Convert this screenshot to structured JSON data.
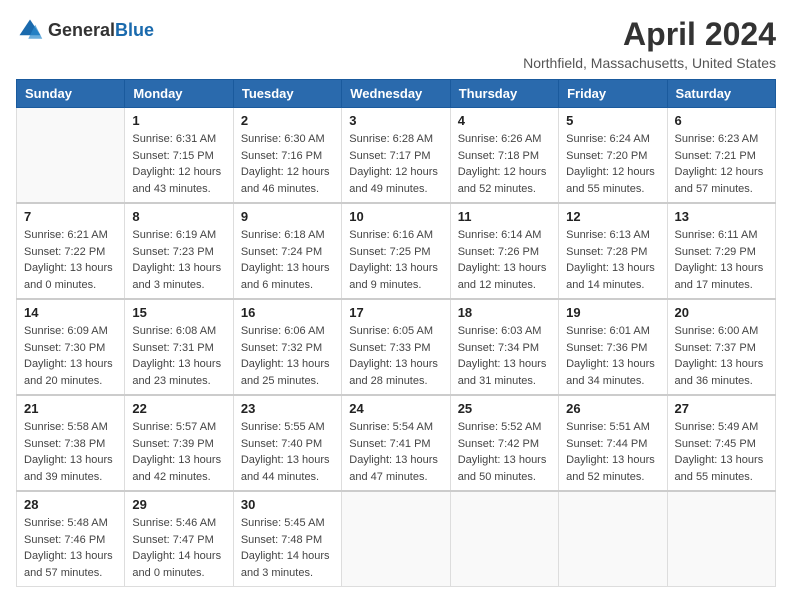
{
  "header": {
    "logo_general": "General",
    "logo_blue": "Blue",
    "month_title": "April 2024",
    "location": "Northfield, Massachusetts, United States"
  },
  "weekdays": [
    "Sunday",
    "Monday",
    "Tuesday",
    "Wednesday",
    "Thursday",
    "Friday",
    "Saturday"
  ],
  "weeks": [
    [
      {
        "day": "",
        "sunrise": "",
        "sunset": "",
        "daylight": ""
      },
      {
        "day": "1",
        "sunrise": "Sunrise: 6:31 AM",
        "sunset": "Sunset: 7:15 PM",
        "daylight": "Daylight: 12 hours and 43 minutes."
      },
      {
        "day": "2",
        "sunrise": "Sunrise: 6:30 AM",
        "sunset": "Sunset: 7:16 PM",
        "daylight": "Daylight: 12 hours and 46 minutes."
      },
      {
        "day": "3",
        "sunrise": "Sunrise: 6:28 AM",
        "sunset": "Sunset: 7:17 PM",
        "daylight": "Daylight: 12 hours and 49 minutes."
      },
      {
        "day": "4",
        "sunrise": "Sunrise: 6:26 AM",
        "sunset": "Sunset: 7:18 PM",
        "daylight": "Daylight: 12 hours and 52 minutes."
      },
      {
        "day": "5",
        "sunrise": "Sunrise: 6:24 AM",
        "sunset": "Sunset: 7:20 PM",
        "daylight": "Daylight: 12 hours and 55 minutes."
      },
      {
        "day": "6",
        "sunrise": "Sunrise: 6:23 AM",
        "sunset": "Sunset: 7:21 PM",
        "daylight": "Daylight: 12 hours and 57 minutes."
      }
    ],
    [
      {
        "day": "7",
        "sunrise": "Sunrise: 6:21 AM",
        "sunset": "Sunset: 7:22 PM",
        "daylight": "Daylight: 13 hours and 0 minutes."
      },
      {
        "day": "8",
        "sunrise": "Sunrise: 6:19 AM",
        "sunset": "Sunset: 7:23 PM",
        "daylight": "Daylight: 13 hours and 3 minutes."
      },
      {
        "day": "9",
        "sunrise": "Sunrise: 6:18 AM",
        "sunset": "Sunset: 7:24 PM",
        "daylight": "Daylight: 13 hours and 6 minutes."
      },
      {
        "day": "10",
        "sunrise": "Sunrise: 6:16 AM",
        "sunset": "Sunset: 7:25 PM",
        "daylight": "Daylight: 13 hours and 9 minutes."
      },
      {
        "day": "11",
        "sunrise": "Sunrise: 6:14 AM",
        "sunset": "Sunset: 7:26 PM",
        "daylight": "Daylight: 13 hours and 12 minutes."
      },
      {
        "day": "12",
        "sunrise": "Sunrise: 6:13 AM",
        "sunset": "Sunset: 7:28 PM",
        "daylight": "Daylight: 13 hours and 14 minutes."
      },
      {
        "day": "13",
        "sunrise": "Sunrise: 6:11 AM",
        "sunset": "Sunset: 7:29 PM",
        "daylight": "Daylight: 13 hours and 17 minutes."
      }
    ],
    [
      {
        "day": "14",
        "sunrise": "Sunrise: 6:09 AM",
        "sunset": "Sunset: 7:30 PM",
        "daylight": "Daylight: 13 hours and 20 minutes."
      },
      {
        "day": "15",
        "sunrise": "Sunrise: 6:08 AM",
        "sunset": "Sunset: 7:31 PM",
        "daylight": "Daylight: 13 hours and 23 minutes."
      },
      {
        "day": "16",
        "sunrise": "Sunrise: 6:06 AM",
        "sunset": "Sunset: 7:32 PM",
        "daylight": "Daylight: 13 hours and 25 minutes."
      },
      {
        "day": "17",
        "sunrise": "Sunrise: 6:05 AM",
        "sunset": "Sunset: 7:33 PM",
        "daylight": "Daylight: 13 hours and 28 minutes."
      },
      {
        "day": "18",
        "sunrise": "Sunrise: 6:03 AM",
        "sunset": "Sunset: 7:34 PM",
        "daylight": "Daylight: 13 hours and 31 minutes."
      },
      {
        "day": "19",
        "sunrise": "Sunrise: 6:01 AM",
        "sunset": "Sunset: 7:36 PM",
        "daylight": "Daylight: 13 hours and 34 minutes."
      },
      {
        "day": "20",
        "sunrise": "Sunrise: 6:00 AM",
        "sunset": "Sunset: 7:37 PM",
        "daylight": "Daylight: 13 hours and 36 minutes."
      }
    ],
    [
      {
        "day": "21",
        "sunrise": "Sunrise: 5:58 AM",
        "sunset": "Sunset: 7:38 PM",
        "daylight": "Daylight: 13 hours and 39 minutes."
      },
      {
        "day": "22",
        "sunrise": "Sunrise: 5:57 AM",
        "sunset": "Sunset: 7:39 PM",
        "daylight": "Daylight: 13 hours and 42 minutes."
      },
      {
        "day": "23",
        "sunrise": "Sunrise: 5:55 AM",
        "sunset": "Sunset: 7:40 PM",
        "daylight": "Daylight: 13 hours and 44 minutes."
      },
      {
        "day": "24",
        "sunrise": "Sunrise: 5:54 AM",
        "sunset": "Sunset: 7:41 PM",
        "daylight": "Daylight: 13 hours and 47 minutes."
      },
      {
        "day": "25",
        "sunrise": "Sunrise: 5:52 AM",
        "sunset": "Sunset: 7:42 PM",
        "daylight": "Daylight: 13 hours and 50 minutes."
      },
      {
        "day": "26",
        "sunrise": "Sunrise: 5:51 AM",
        "sunset": "Sunset: 7:44 PM",
        "daylight": "Daylight: 13 hours and 52 minutes."
      },
      {
        "day": "27",
        "sunrise": "Sunrise: 5:49 AM",
        "sunset": "Sunset: 7:45 PM",
        "daylight": "Daylight: 13 hours and 55 minutes."
      }
    ],
    [
      {
        "day": "28",
        "sunrise": "Sunrise: 5:48 AM",
        "sunset": "Sunset: 7:46 PM",
        "daylight": "Daylight: 13 hours and 57 minutes."
      },
      {
        "day": "29",
        "sunrise": "Sunrise: 5:46 AM",
        "sunset": "Sunset: 7:47 PM",
        "daylight": "Daylight: 14 hours and 0 minutes."
      },
      {
        "day": "30",
        "sunrise": "Sunrise: 5:45 AM",
        "sunset": "Sunset: 7:48 PM",
        "daylight": "Daylight: 14 hours and 3 minutes."
      },
      {
        "day": "",
        "sunrise": "",
        "sunset": "",
        "daylight": ""
      },
      {
        "day": "",
        "sunrise": "",
        "sunset": "",
        "daylight": ""
      },
      {
        "day": "",
        "sunrise": "",
        "sunset": "",
        "daylight": ""
      },
      {
        "day": "",
        "sunrise": "",
        "sunset": "",
        "daylight": ""
      }
    ]
  ]
}
